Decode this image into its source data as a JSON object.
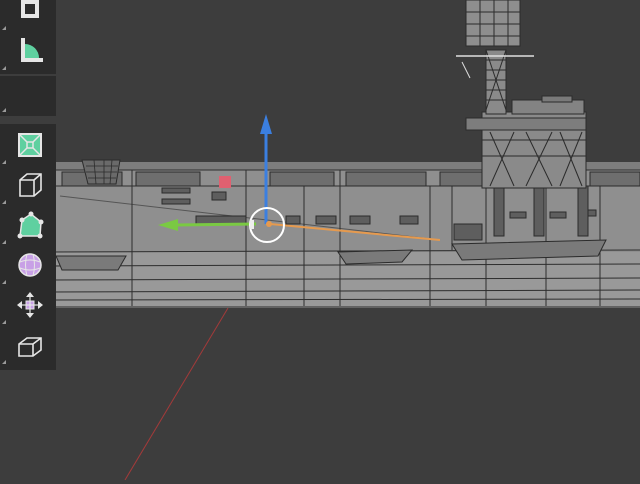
{
  "app": {
    "view": "3D Viewport"
  },
  "toolbar": {
    "top_tools": [
      {
        "name": "transform-tool",
        "icon": "transform-icon"
      },
      {
        "name": "measure-tool",
        "icon": "measure-icon"
      }
    ],
    "main_tools": [
      {
        "name": "add-cube-tool",
        "icon": "add-cube-icon"
      },
      {
        "name": "extrude-tool",
        "icon": "extrude-icon"
      },
      {
        "name": "poly-build-tool",
        "icon": "poly-build-icon"
      },
      {
        "name": "smooth-tool",
        "icon": "smooth-icon"
      },
      {
        "name": "move-tool",
        "icon": "move-icon"
      },
      {
        "name": "shear-tool",
        "icon": "shear-icon"
      }
    ]
  },
  "colors": {
    "background": "#3d3d3d",
    "toolbar_bg": "#2b2b2b",
    "hull": "#8c8c8c",
    "wire": "#2e2e2e",
    "gizmo_z": "#3b7fe0",
    "gizmo_y": "#7ac943",
    "gizmo_x": "#e69a4e",
    "selection": "#e06070",
    "active_icon": "#5fd0a0",
    "smooth_icon": "#c8a0e6"
  },
  "gizmo": {
    "mode": "move",
    "axes": [
      "Z",
      "Y",
      "X"
    ]
  }
}
